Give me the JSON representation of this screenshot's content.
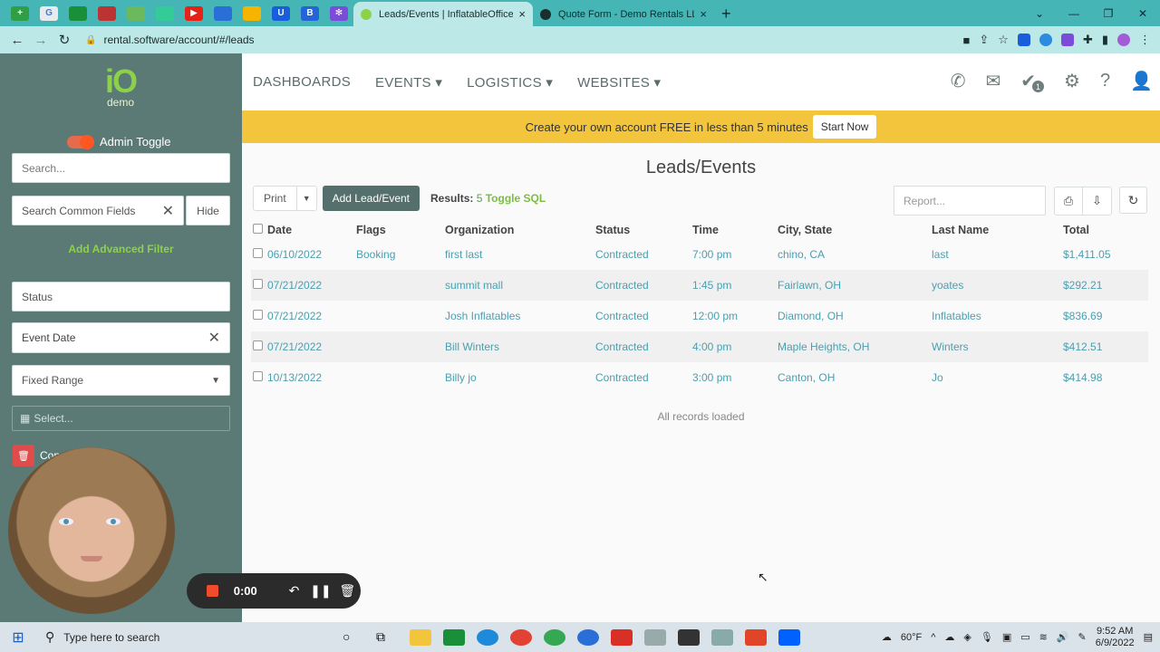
{
  "browser": {
    "tabs": [
      {
        "title": "Leads/Events | InflatableOffice",
        "active": true
      },
      {
        "title": "Quote Form - Demo Rentals LLC",
        "active": false
      }
    ],
    "url": "rental.software/account/#/leads"
  },
  "sidebar": {
    "logo_text": "iO",
    "logo_sub": "demo",
    "admin_toggle_label": "Admin Toggle",
    "search_placeholder": "Search...",
    "common_fields_placeholder": "Search Common Fields",
    "hide_label": "Hide",
    "advanced_filter_label": "Add Advanced Filter",
    "status_placeholder": "Status",
    "event_date_label": "Event Date",
    "range_selected": "Fixed Range",
    "date_select_placeholder": "Select...",
    "trash_label": "Con"
  },
  "recorder": {
    "time": "0:00"
  },
  "header": {
    "menu": [
      "DASHBOARDS",
      "EVENTS ▾",
      "LOGISTICS ▾",
      "WEBSITES ▾"
    ],
    "tasks_badge": "1"
  },
  "promo": {
    "text": "Create your own account FREE in less than 5 minutes",
    "button": "Start Now"
  },
  "main": {
    "title": "Leads/Events",
    "print_label": "Print",
    "add_lead_label": "Add Lead/Event",
    "results_label": "Results:",
    "results_count": "5",
    "toggle_sql_label": "Toggle SQL",
    "report_placeholder": "Report...",
    "columns": [
      "Date",
      "Flags",
      "Organization",
      "Status",
      "Time",
      "City, State",
      "Last Name",
      "Total"
    ],
    "rows": [
      {
        "date": "06/10/2022",
        "flag": "Booking",
        "org": "first last",
        "status": "Contracted",
        "time": "7:00 pm",
        "city": "chino, CA",
        "last": "last",
        "total": "$1,411.05"
      },
      {
        "date": "07/21/2022",
        "flag": "",
        "org": "summit mall",
        "status": "Contracted",
        "time": "1:45 pm",
        "city": "Fairlawn, OH",
        "last": "yoates",
        "total": "$292.21"
      },
      {
        "date": "07/21/2022",
        "flag": "",
        "org": "Josh Inflatables",
        "status": "Contracted",
        "time": "12:00 pm",
        "city": "Diamond, OH",
        "last": "Inflatables",
        "total": "$836.69"
      },
      {
        "date": "07/21/2022",
        "flag": "",
        "org": "Bill Winters",
        "status": "Contracted",
        "time": "4:00 pm",
        "city": "Maple Heights, OH",
        "last": "Winters",
        "total": "$412.51"
      },
      {
        "date": "10/13/2022",
        "flag": "",
        "org": "Billy jo",
        "status": "Contracted",
        "time": "3:00 pm",
        "city": "Canton, OH",
        "last": "Jo",
        "total": "$414.98"
      }
    ],
    "footer": "All records loaded"
  },
  "taskbar": {
    "search_placeholder": "Type here to search",
    "weather": "60°F",
    "time": "9:52 AM",
    "date": "6/9/2022"
  },
  "colors": {
    "sidebar_bg": "#5b7a76",
    "accent_green": "#8cd14a",
    "promo_bg": "#f2c53d",
    "link_teal": "#4a9fb0",
    "flag_red": "#e05a50",
    "tab_bar": "#45b5b5"
  }
}
